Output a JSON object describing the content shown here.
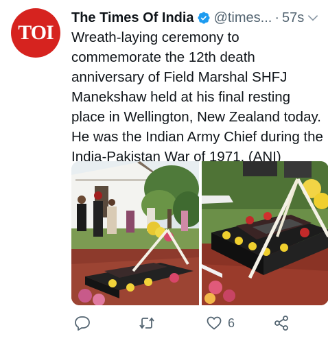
{
  "account": {
    "avatar_text": "TOI",
    "name": "The Times Of India",
    "handle": "@times...",
    "separator": "·",
    "time": "57s"
  },
  "tweet": {
    "lines": [
      "Wreath-laying ceremony to",
      "commemorate the 12th death",
      "anniversary of Field Marshal SHFJ",
      "Manekshaw held at his final resting",
      "place in Wellington, New Zealand today.",
      "He was the Indian Army Chief during the",
      "India-Pakistan War of 1971. (ANI)"
    ]
  },
  "actions": {
    "reply_icon": "reply-icon",
    "retweet_icon": "retweet-icon",
    "like_icon": "heart-icon",
    "like_count": "6",
    "share_icon": "share-icon"
  },
  "colors": {
    "brand_red": "#d6231f",
    "verified_blue": "#1d9bf0",
    "muted": "#536471"
  }
}
